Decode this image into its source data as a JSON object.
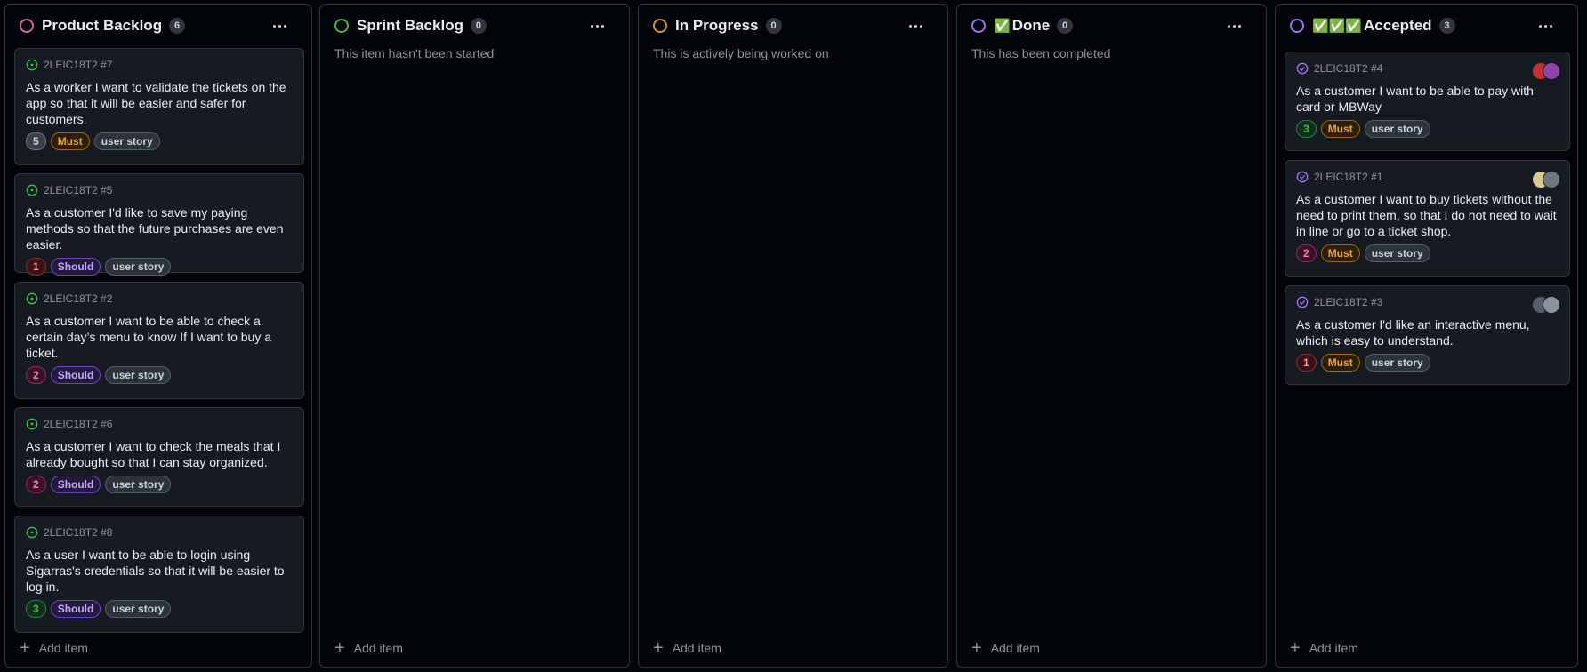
{
  "add_item_label": "Add item",
  "columns": [
    {
      "title": "Product Backlog",
      "emoji": "",
      "count": "6",
      "ring_color": "#db61a2",
      "description": "",
      "cards": [
        {
          "ref": "2LEIC18T2 #7",
          "title": "As a worker I want to validate the tickets on the app so that it will be easier and safer for customers.",
          "points": "5",
          "priority": "Must",
          "type": "user story",
          "status": "open"
        },
        {
          "ref": "2LEIC18T2 #5",
          "title": "As a customer I'd like to save my paying methods so that the future purchases are even easier.",
          "points": "1",
          "priority": "Should",
          "type": "user story",
          "status": "open"
        },
        {
          "ref": "2LEIC18T2 #2",
          "title": "As a customer I want to be able to check a certain day’s menu to know If I want to buy a ticket.",
          "points": "2",
          "priority": "Should",
          "type": "user story",
          "status": "open"
        },
        {
          "ref": "2LEIC18T2 #6",
          "title": "As a customer I want to check the meals that I already bought so that I can stay organized.",
          "points": "2",
          "priority": "Should",
          "type": "user story",
          "status": "open"
        },
        {
          "ref": "2LEIC18T2 #8",
          "title": "As a user I want to be able to login using Sigarras's credentials so that it will be easier to log in.",
          "points": "3",
          "priority": "Should",
          "type": "user story",
          "status": "open"
        }
      ]
    },
    {
      "title": "Sprint Backlog",
      "emoji": "",
      "count": "0",
      "ring_color": "#3fb950",
      "description": "This item hasn't been started",
      "cards": []
    },
    {
      "title": "In Progress",
      "emoji": "",
      "count": "0",
      "ring_color": "#d29922",
      "description": "This is actively being worked on",
      "cards": []
    },
    {
      "title": "Done",
      "emoji": "✅",
      "count": "0",
      "ring_color": "#a371f7",
      "description": "This has been completed",
      "cards": []
    },
    {
      "title": "Accepted",
      "emoji": "✅✅✅",
      "count": "3",
      "ring_color": "#a371f7",
      "description": "",
      "cards": [
        {
          "ref": "2LEIC18T2 #4",
          "title": "As a customer I want to be able to pay with card or MBWay",
          "points": "3",
          "priority": "Must",
          "type": "user story",
          "status": "closed"
        },
        {
          "ref": "2LEIC18T2 #1",
          "title": "As a customer I want to buy tickets without the need to print them, so that I do not need to wait in line or go to a ticket shop.",
          "points": "2",
          "priority": "Must",
          "type": "user story",
          "status": "closed"
        },
        {
          "ref": "2LEIC18T2 #3",
          "title": "As a customer I'd like an interactive menu, which is easy to understand.",
          "points": "1",
          "priority": "Must",
          "type": "user story",
          "status": "closed"
        }
      ]
    }
  ],
  "colors": {
    "background": "#010409",
    "card": "#161b22",
    "border": "#30363d",
    "open_issue": "#3fb950",
    "closed_issue": "#a371f7"
  }
}
